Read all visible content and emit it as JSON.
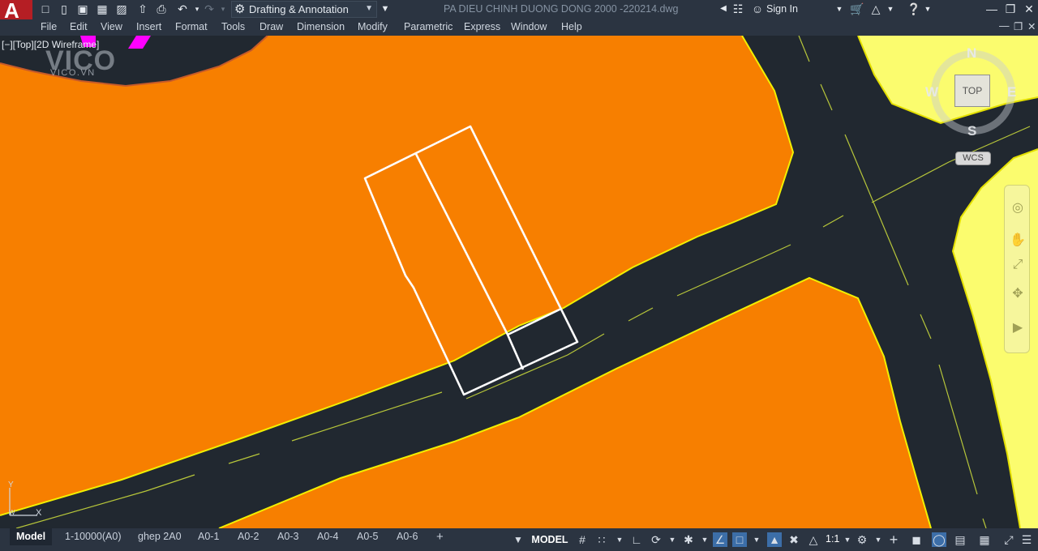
{
  "app": {
    "logo_letter": "A",
    "document_title": "PA DIEU CHINH DUONG DONG 2000 -220214.dwg",
    "workspace": "Drafting & Annotation",
    "sign_in": "Sign In"
  },
  "menu": [
    "File",
    "Edit",
    "View",
    "Insert",
    "Format",
    "Tools",
    "Draw",
    "Dimension",
    "Modify",
    "Parametric",
    "Express",
    "Window",
    "Help"
  ],
  "viewport": {
    "label": "[−][Top][2D Wireframe]",
    "watermark_brand": "VICO",
    "watermark_site": "VICO.VN",
    "viewcube": {
      "north": "N",
      "south": "S",
      "east": "E",
      "west": "W",
      "face": "TOP",
      "ucs": "WCS"
    },
    "ucs_axes": {
      "x": "X",
      "y": "Y",
      "w": "W"
    }
  },
  "layout_tabs": [
    "Model",
    "1-10000(A0)",
    "ghep 2A0",
    "A0-1",
    "A0-2",
    "A0-3",
    "A0-4",
    "A0-5",
    "A0-6"
  ],
  "status": {
    "model": "MODEL",
    "scale": "1:1"
  },
  "colors": {
    "lot_fill": "#f77f00",
    "road": "#212830",
    "yellow_zone": "#fbfc6e",
    "boundary": "#f2ef00",
    "parcel_outline": "#ffffff",
    "magenta": "#ff00ff",
    "ui_bg": "#2b3441",
    "logo_red": "#b51e24"
  },
  "icons": {
    "quick_access": [
      "new-icon",
      "open-icon",
      "save-icon",
      "save-as-icon",
      "upload-icon",
      "plot-icon",
      "undo-icon",
      "redo-icon"
    ],
    "window_controls": [
      "minimize-icon",
      "restore-icon",
      "close-icon"
    ],
    "navbar": [
      "steering-wheel-icon",
      "pan-icon",
      "zoom-extents-icon",
      "orbit-icon",
      "showmotion-icon"
    ]
  }
}
